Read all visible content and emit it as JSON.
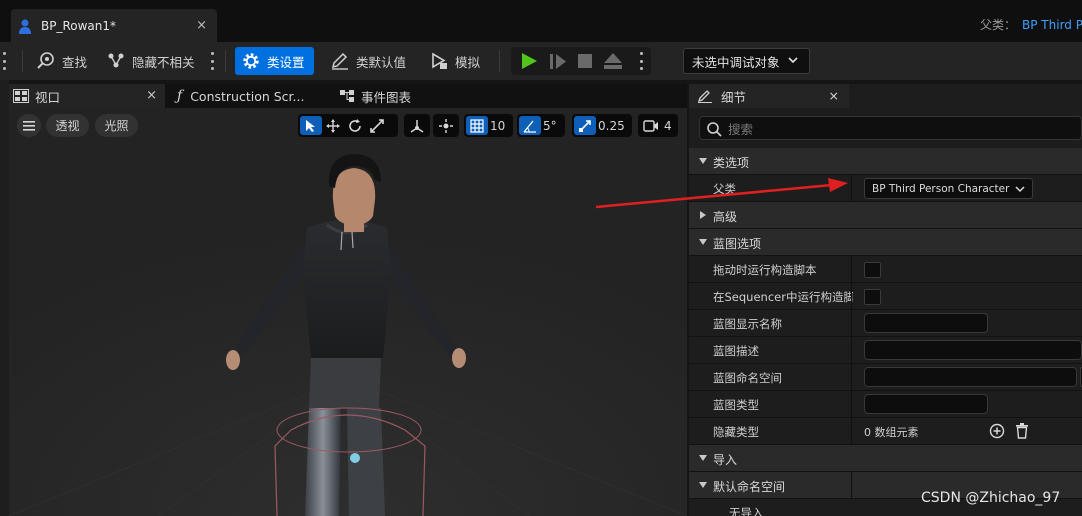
{
  "document_tab": {
    "title": "BP_Rowan1*",
    "close": "×"
  },
  "parent_info": {
    "label": "父类：",
    "value": "BP Third P"
  },
  "toolbar": {
    "find": "查找",
    "hide_unrelated": "隐藏不相关",
    "class_settings": "类设置",
    "class_defaults": "类默认值",
    "simulate": "模拟",
    "debug_object": "未选中调试对象"
  },
  "panels": {
    "viewport_tab": "视口",
    "construction_tab": "Construction Scr...",
    "event_graph_tab": "事件图表",
    "close": "×"
  },
  "viewport": {
    "perspective": "透视",
    "lighting": "光照",
    "grid_snap": "10",
    "rotation_snap": "5°",
    "scale_snap": "0.25",
    "camera_speed": "4"
  },
  "details": {
    "tab_title": "细节",
    "close": "×",
    "search_placeholder": "搜索",
    "rows": [
      {
        "kind": "category",
        "expanded": true,
        "label": "类选项"
      },
      {
        "kind": "parent",
        "label": "父类",
        "value": "BP Third Person Character"
      },
      {
        "kind": "category",
        "expanded": false,
        "label": "高级"
      },
      {
        "kind": "category",
        "expanded": true,
        "label": "蓝图选项"
      },
      {
        "kind": "checkbox",
        "label": "拖动时运行构造脚本"
      },
      {
        "kind": "checkbox",
        "label": "在Sequencer中运行构造脚..."
      },
      {
        "kind": "text",
        "label": "蓝图显示名称",
        "value": ""
      },
      {
        "kind": "text-wide",
        "label": "蓝图描述",
        "value": ""
      },
      {
        "kind": "text-wide",
        "label": "蓝图命名空间",
        "value": ""
      },
      {
        "kind": "text",
        "label": "蓝图类型",
        "value": ""
      },
      {
        "kind": "array",
        "label": "隐藏类型",
        "value": "0 数组元素"
      },
      {
        "kind": "category",
        "expanded": true,
        "label": "导入"
      },
      {
        "kind": "category",
        "expanded": true,
        "label": "默认命名空间"
      },
      {
        "kind": "sub",
        "label": "无导入"
      }
    ]
  },
  "watermark": "CSDN @Zhichao_97",
  "colors": {
    "accent": "#0070e0",
    "link": "#3ea0ff",
    "play": "#52c41a",
    "annotation_arrow": "#e02020"
  }
}
